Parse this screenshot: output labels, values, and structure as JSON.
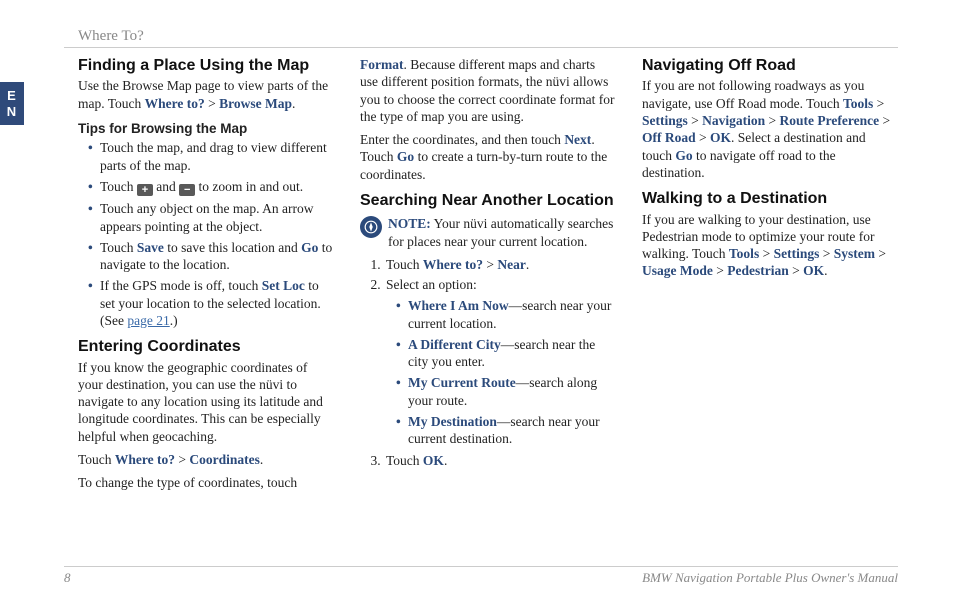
{
  "lang_tab": {
    "line1": "E",
    "line2": "N"
  },
  "header_crumb": "Where To?",
  "sections": {
    "finding_map": {
      "title": "Finding a Place Using the Map",
      "intro_a": "Use the Browse Map page to view parts of the map. Touch ",
      "intro_link1": "Where to?",
      "intro_sep": " > ",
      "intro_link2": "Browse Map",
      "intro_end": "."
    },
    "tips": {
      "title": "Tips for Browsing the Map",
      "b1": "Touch the map, and drag to view different parts of the map.",
      "b2_a": "Touch ",
      "b2_b": " and ",
      "b2_c": " to zoom in and out.",
      "b3": "Touch any object on the map. An arrow appears pointing at the object.",
      "b4_a": "Touch ",
      "b4_save": "Save",
      "b4_b": " to save this location and ",
      "b4_go": "Go",
      "b4_c": " to navigate to the location.",
      "b5_a": "If the GPS mode is off, touch ",
      "b5_setloc": "Set Loc",
      "b5_b": " to set your location to the selected location. (See ",
      "b5_page": "page 21",
      "b5_c": ".)"
    },
    "entering": {
      "title": "Entering Coordinates",
      "p1": "If you know the geographic coordinates of your destination, you can use the nüvi to navigate to any location using its latitude and longitude coordinates. This can be especially helpful when geocaching.",
      "p2_a": "Touch ",
      "p2_l1": "Where to?",
      "p2_sep": " > ",
      "p2_l2": "Coordinates",
      "p2_end": ".",
      "p3": "To change the type of coordinates, touch ",
      "p3_link": "Format",
      "p3_b": ". Because different maps and charts use different position formats, the nüvi allows you to choose the correct coordinate format for the type of map you are using.",
      "p4_a": "Enter the coordinates, and then touch ",
      "p4_next": "Next",
      "p4_b": ". Touch ",
      "p4_go": "Go",
      "p4_c": " to create a turn-by-turn route to the coordinates."
    },
    "searching": {
      "title": "Searching Near Another Location",
      "note_label": "NOTE:",
      "note_text": " Your nüvi automatically searches for places near your current location.",
      "s1_a": "Touch ",
      "s1_l1": "Where to?",
      "s1_sep": " > ",
      "s1_l2": "Near",
      "s1_end": ".",
      "s2": "Select an option:",
      "opt1_l": "Where I Am Now",
      "opt1_t": "—search near your current location.",
      "opt2_l": "A Different City",
      "opt2_t": "—search near the city you enter.",
      "opt3_l": "My Current Route",
      "opt3_t": "—search along your route.",
      "opt4_l": "My Destination",
      "opt4_t": "—search near your current destination.",
      "s3_a": "Touch ",
      "s3_ok": "OK",
      "s3_b": "."
    },
    "offroad": {
      "title": "Navigating Off Road",
      "a": "If you are not following roadways as you navigate, use Off Road mode. Touch ",
      "l1": "Tools",
      "l2": "Settings",
      "l3": "Navigation",
      "l4": "Route Preference",
      "l5": "Off Road",
      "l6": "OK",
      "sep": " > ",
      "b": ". Select a destination and touch ",
      "go": "Go",
      "c": " to navigate off road to the destination."
    },
    "walking": {
      "title": "Walking to a Destination",
      "a": "If you are walking to your destination, use Pedestrian mode to optimize your route for walking. Touch ",
      "l1": "Tools",
      "l2": "Settings",
      "l3": "System",
      "l4": "Usage Mode",
      "l5": "Pedestrian",
      "l6": "OK",
      "sep": " > ",
      "end": "."
    }
  },
  "footer": {
    "page": "8",
    "doc": "BMW Navigation Portable Plus Owner's Manual"
  },
  "icons": {
    "plus": "+",
    "minus": "−"
  }
}
